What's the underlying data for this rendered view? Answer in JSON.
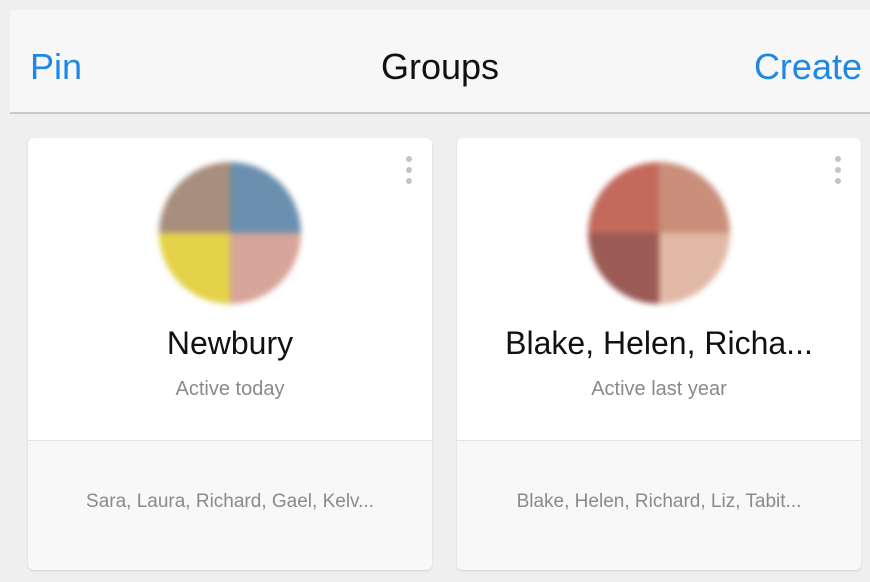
{
  "navbar": {
    "left_label": "Pin",
    "title": "Groups",
    "right_label": "Create"
  },
  "groups": [
    {
      "name": "Newbury",
      "status": "Active today",
      "members": "Sara, Laura, Richard, Gael, Kelv..."
    },
    {
      "name": "Blake, Helen, Richa...",
      "status": "Active last year",
      "members": "Blake, Helen, Richard, Liz, Tabit..."
    }
  ],
  "icons": {
    "more": "more-vertical-icon",
    "avatar": "group-avatar-image"
  },
  "colors": {
    "accent": "#1f87e5",
    "background": "#efefef"
  }
}
